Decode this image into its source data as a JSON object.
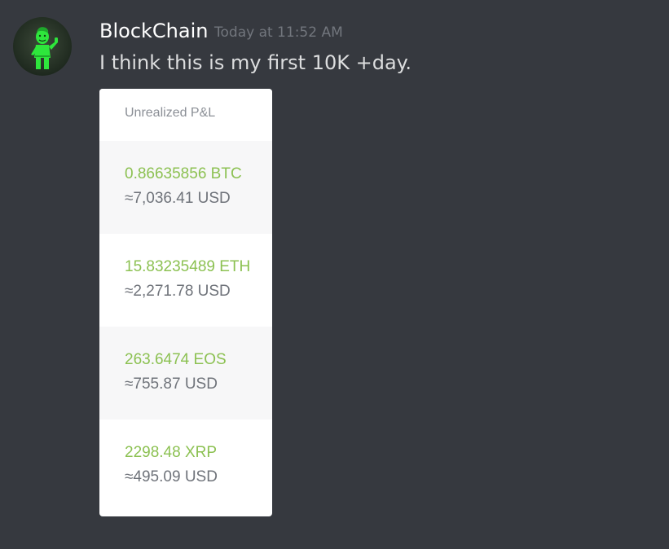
{
  "message": {
    "author": "BlockChain",
    "timestamp": "Today at 11:52 AM",
    "text": "I think this is my first 10K +day."
  },
  "avatar": {
    "icon": "vault-boy-icon",
    "accent_color": "#2ee63c"
  },
  "pnl_card": {
    "title": "Unrealized P&L",
    "rows": [
      {
        "amount": "0.86635856 BTC",
        "usd": "≈7,036.41 USD"
      },
      {
        "amount": "15.83235489 ETH",
        "usd": "≈2,271.78 USD"
      },
      {
        "amount": "263.6474 EOS",
        "usd": "≈755.87 USD"
      },
      {
        "amount": "2298.48 XRP",
        "usd": "≈495.09 USD"
      }
    ],
    "colors": {
      "positive": "#8cc152",
      "muted": "#6f737a"
    }
  },
  "theme": {
    "background": "#36393f",
    "username_color": "#ffffff",
    "timestamp_color": "#72767d",
    "text_color": "#dcddde"
  }
}
